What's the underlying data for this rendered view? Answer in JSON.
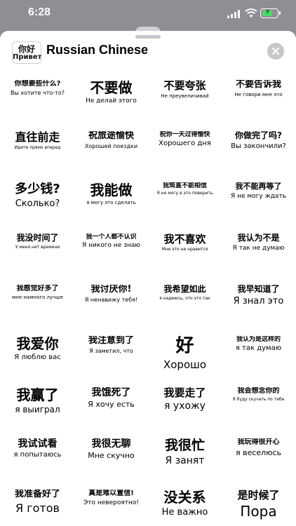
{
  "status": {
    "time": "6:28"
  },
  "header": {
    "title": "Russian Chinese",
    "icon_zh": "你好",
    "icon_ru": "Привет"
  },
  "stickers": [
    {
      "zh": "你想要些什么?",
      "ru": "Вы хотите что-то?",
      "zs": 10,
      "rs": 8
    },
    {
      "zh": "不要做",
      "ru": "Не делай этого",
      "zs": 20,
      "rs": 9
    },
    {
      "zh": "不要夸张",
      "ru": "Не преувеличивай",
      "zs": 15,
      "rs": 7
    },
    {
      "zh": "不要告诉我",
      "ru": "Не говори мне это",
      "zs": 13,
      "rs": 7
    },
    {
      "zh": "直往前走",
      "ru": "Идите прямо вперед",
      "zs": 16,
      "rs": 6
    },
    {
      "zh": "祝旅途愉快",
      "ru": "Хорошей поездки",
      "zs": 13,
      "rs": 8
    },
    {
      "zh": "祝你一天过得愉快",
      "ru": "Хорошего дня",
      "zs": 9,
      "rs": 10
    },
    {
      "zh": "你做完了吗?",
      "ru": "Вы закончили?",
      "zs": 12,
      "rs": 10
    },
    {
      "zh": "多少钱?",
      "ru": "Сколько?",
      "zs": 18,
      "rs": 13
    },
    {
      "zh": "我能做",
      "ru": "я могу это сделать",
      "zs": 20,
      "rs": 7
    },
    {
      "zh": "我简直不能相信",
      "ru": "Я не могу в это поверить",
      "zs": 9,
      "rs": 6
    },
    {
      "zh": "我不能再等了",
      "ru": "Я не могу ждать",
      "zs": 11,
      "rs": 9
    },
    {
      "zh": "我没时间了",
      "ru": "У меня нет времени",
      "zs": 12,
      "rs": 6
    },
    {
      "zh": "我一个人都不认识",
      "ru": "Я никого не знаю",
      "zs": 9,
      "rs": 9
    },
    {
      "zh": "我不喜欢",
      "ru": "Мне это не нравится",
      "zs": 15,
      "rs": 6
    },
    {
      "zh": "我认为不是",
      "ru": "Я так не думаю",
      "zs": 12,
      "rs": 9
    },
    {
      "zh": "我感觉好多了",
      "ru": "мне намного лучше",
      "zs": 10,
      "rs": 7
    },
    {
      "zh": "我讨厌你!",
      "ru": "Я ненавижу тебя!",
      "zs": 13,
      "rs": 8
    },
    {
      "zh": "我希望如此",
      "ru": "я надеюсь, что это так",
      "zs": 12,
      "rs": 6
    },
    {
      "zh": "我早知道了",
      "ru": "Я знал это",
      "zs": 12,
      "rs": 13
    },
    {
      "zh": "我爱你",
      "ru": "Я люблю вас",
      "zs": 20,
      "rs": 10
    },
    {
      "zh": "我注意到了",
      "ru": "Я заметил, что",
      "zs": 13,
      "rs": 8
    },
    {
      "zh": "好",
      "ru": "Хорошо",
      "zs": 26,
      "rs": 15
    },
    {
      "zh": "我认为是这样的",
      "ru": "я так думаю",
      "zs": 9,
      "rs": 10
    },
    {
      "zh": "我赢了",
      "ru": "я выиграл",
      "zs": 20,
      "rs": 12
    },
    {
      "zh": "我饿死了",
      "ru": "Я хочу есть",
      "zs": 14,
      "rs": 11
    },
    {
      "zh": "我要走了",
      "ru": "я ухожу",
      "zs": 15,
      "rs": 14
    },
    {
      "zh": "我会想念你的",
      "ru": "Я буду скучать по тебе",
      "zs": 10,
      "rs": 6
    },
    {
      "zh": "我试试看",
      "ru": "я попытаюсь",
      "zs": 14,
      "rs": 10
    },
    {
      "zh": "我很无聊",
      "ru": "Мне скучно",
      "zs": 14,
      "rs": 11
    },
    {
      "zh": "我很忙",
      "ru": "Я занят",
      "zs": 19,
      "rs": 14
    },
    {
      "zh": "我玩得很开心",
      "ru": "я веселюсь",
      "zs": 10,
      "rs": 11
    },
    {
      "zh": "我准备好了",
      "ru": "Я готов",
      "zs": 13,
      "rs": 16
    },
    {
      "zh": "真是难以置信!",
      "ru": "Это невероятно!",
      "zs": 10,
      "rs": 9
    },
    {
      "zh": "没关系",
      "ru": "Не важно",
      "zs": 20,
      "rs": 13
    },
    {
      "zh": "是时候了",
      "ru": "Пора",
      "zs": 15,
      "rs": 20
    }
  ]
}
